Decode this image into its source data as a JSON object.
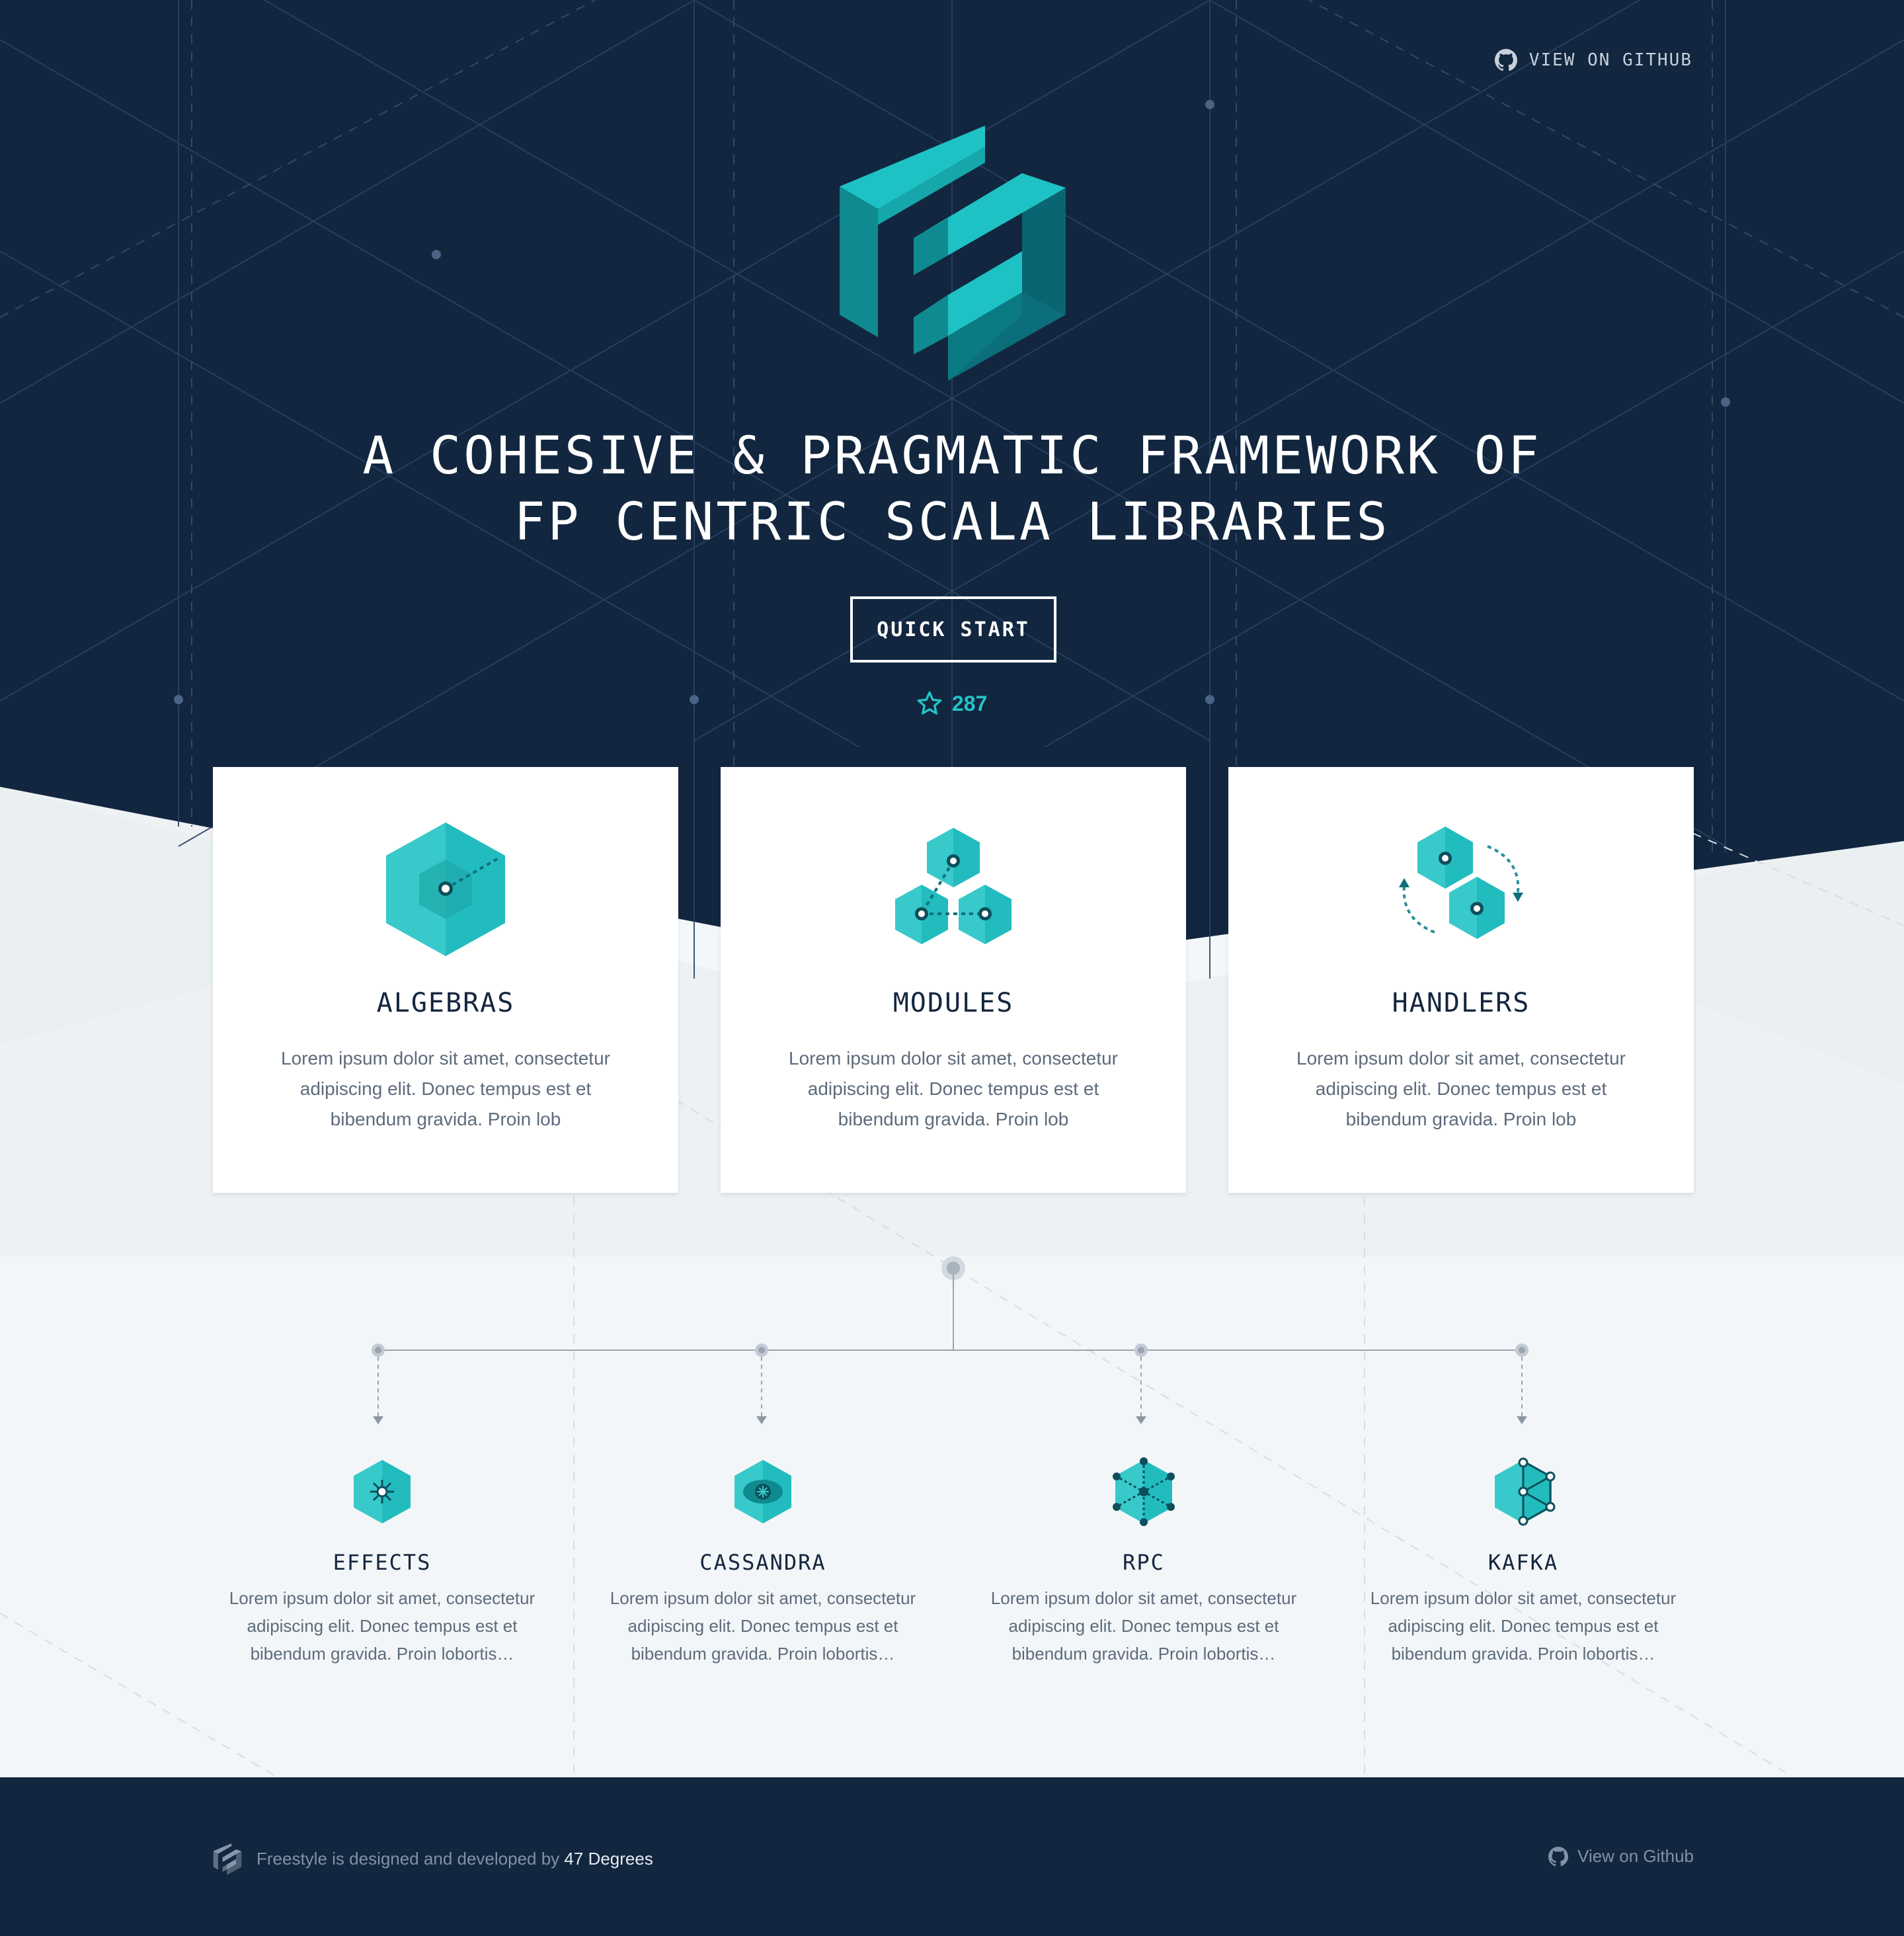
{
  "header": {
    "github_link": "VIEW ON GITHUB"
  },
  "hero": {
    "headline_line1": "A COHESIVE & PRAGMATIC FRAMEWORK OF",
    "headline_line2": "FP CENTRIC SCALA LIBRARIES",
    "cta_label": "QUICK START",
    "star_count": "287"
  },
  "features": [
    {
      "title": "ALGEBRAS",
      "text": "Lorem ipsum dolor sit amet, consectetur adipiscing elit. Donec tempus est et bibendum gravida. Proin lob",
      "icon": "algebras-hexagon-icon"
    },
    {
      "title": "MODULES",
      "text": "Lorem ipsum dolor sit amet, consectetur adipiscing elit. Donec tempus est et bibendum gravida. Proin lob",
      "icon": "modules-hexagons-icon"
    },
    {
      "title": "HANDLERS",
      "text": "Lorem ipsum dolor sit amet, consectetur adipiscing elit. Donec tempus est et bibendum gravida. Proin lob",
      "icon": "handlers-cycle-icon"
    }
  ],
  "integrations": [
    {
      "title": "EFFECTS",
      "text": "Lorem ipsum dolor sit amet, consectetur adipiscing elit. Donec tempus est et bibendum gravida. Proin lobortis…",
      "icon": "effects-icon"
    },
    {
      "title": "CASSANDRA",
      "text": "Lorem ipsum dolor sit amet, consectetur adipiscing elit. Donec tempus est et bibendum gravida. Proin lobortis…",
      "icon": "cassandra-eye-icon"
    },
    {
      "title": "RPC",
      "text": "Lorem ipsum dolor sit amet, consectetur adipiscing elit. Donec tempus est et bibendum gravida. Proin lobortis…",
      "icon": "rpc-network-icon"
    },
    {
      "title": "KAFKA",
      "text": "Lorem ipsum dolor sit amet, consectetur adipiscing elit. Donec tempus est et bibendum gravida. Proin lobortis…",
      "icon": "kafka-graph-icon"
    }
  ],
  "footer": {
    "credit_prefix": "Freestyle is designed and developed by ",
    "credit_company": "47 Degrees",
    "github_link": "View on Github"
  },
  "colors": {
    "navy": "#12263f",
    "teal": "#22c4c8",
    "teal_dark": "#0f8a8f",
    "light_bg": "#f3f6f8"
  }
}
